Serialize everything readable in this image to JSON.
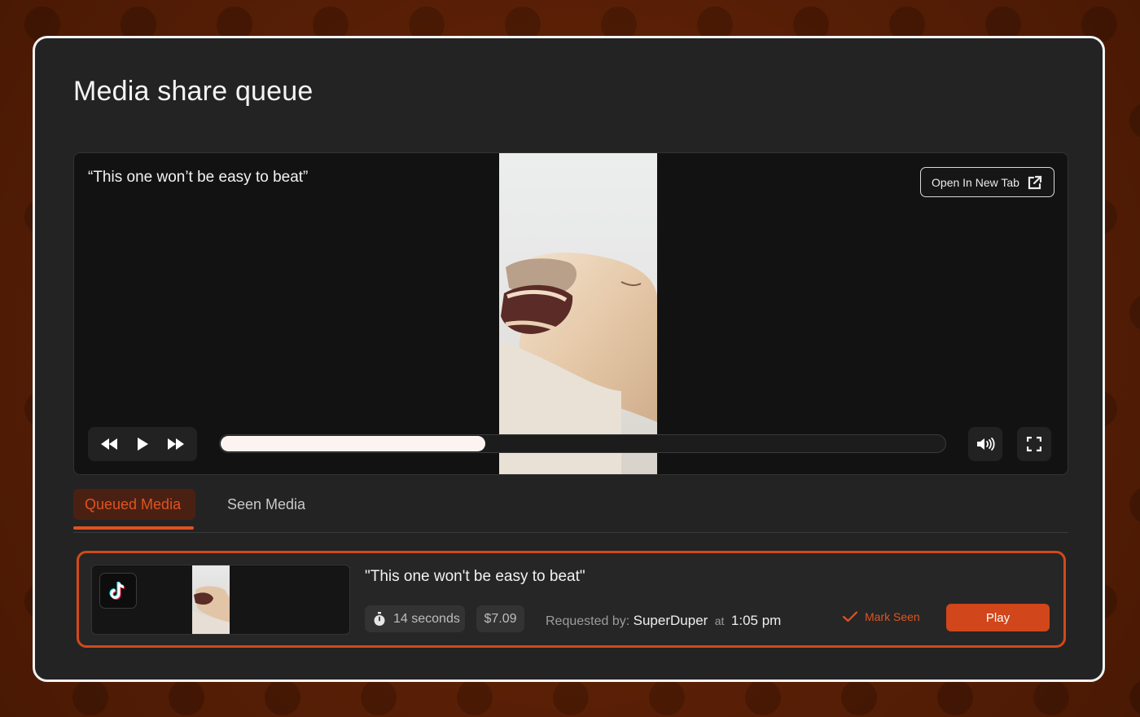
{
  "page": {
    "title": "Media share queue"
  },
  "player": {
    "caption": "“This one won’t be easy to beat”",
    "open_new_tab_label": "Open In New Tab",
    "progress_fraction": 0.365,
    "controls": {
      "rewind_icon": "rewind-icon",
      "play_icon": "play-icon",
      "fast_forward_icon": "fast-forward-icon",
      "volume_icon": "volume-icon",
      "fullscreen_icon": "fullscreen-icon",
      "external_link_icon": "external-link-icon"
    }
  },
  "tabs": [
    {
      "label": "Queued Media",
      "active": true
    },
    {
      "label": "Seen Media",
      "active": false
    }
  ],
  "queue": [
    {
      "platform_icon": "tiktok-icon",
      "caption": "\"This one won't be easy to beat\"",
      "duration": "14 seconds",
      "duration_icon": "stopwatch-icon",
      "price": "$7.09",
      "requested_label": "Requested by:",
      "requested_by": "SuperDuper",
      "at_label": "at",
      "time": "1:05 pm",
      "mark_seen_label": "Mark Seen",
      "mark_seen_icon": "checkmark-icon",
      "play_label": "Play"
    }
  ],
  "colors": {
    "accent": "#d1461a",
    "accent_text": "#e1531f",
    "panel_bg": "#232323",
    "page_bg": "#5a1e06"
  }
}
